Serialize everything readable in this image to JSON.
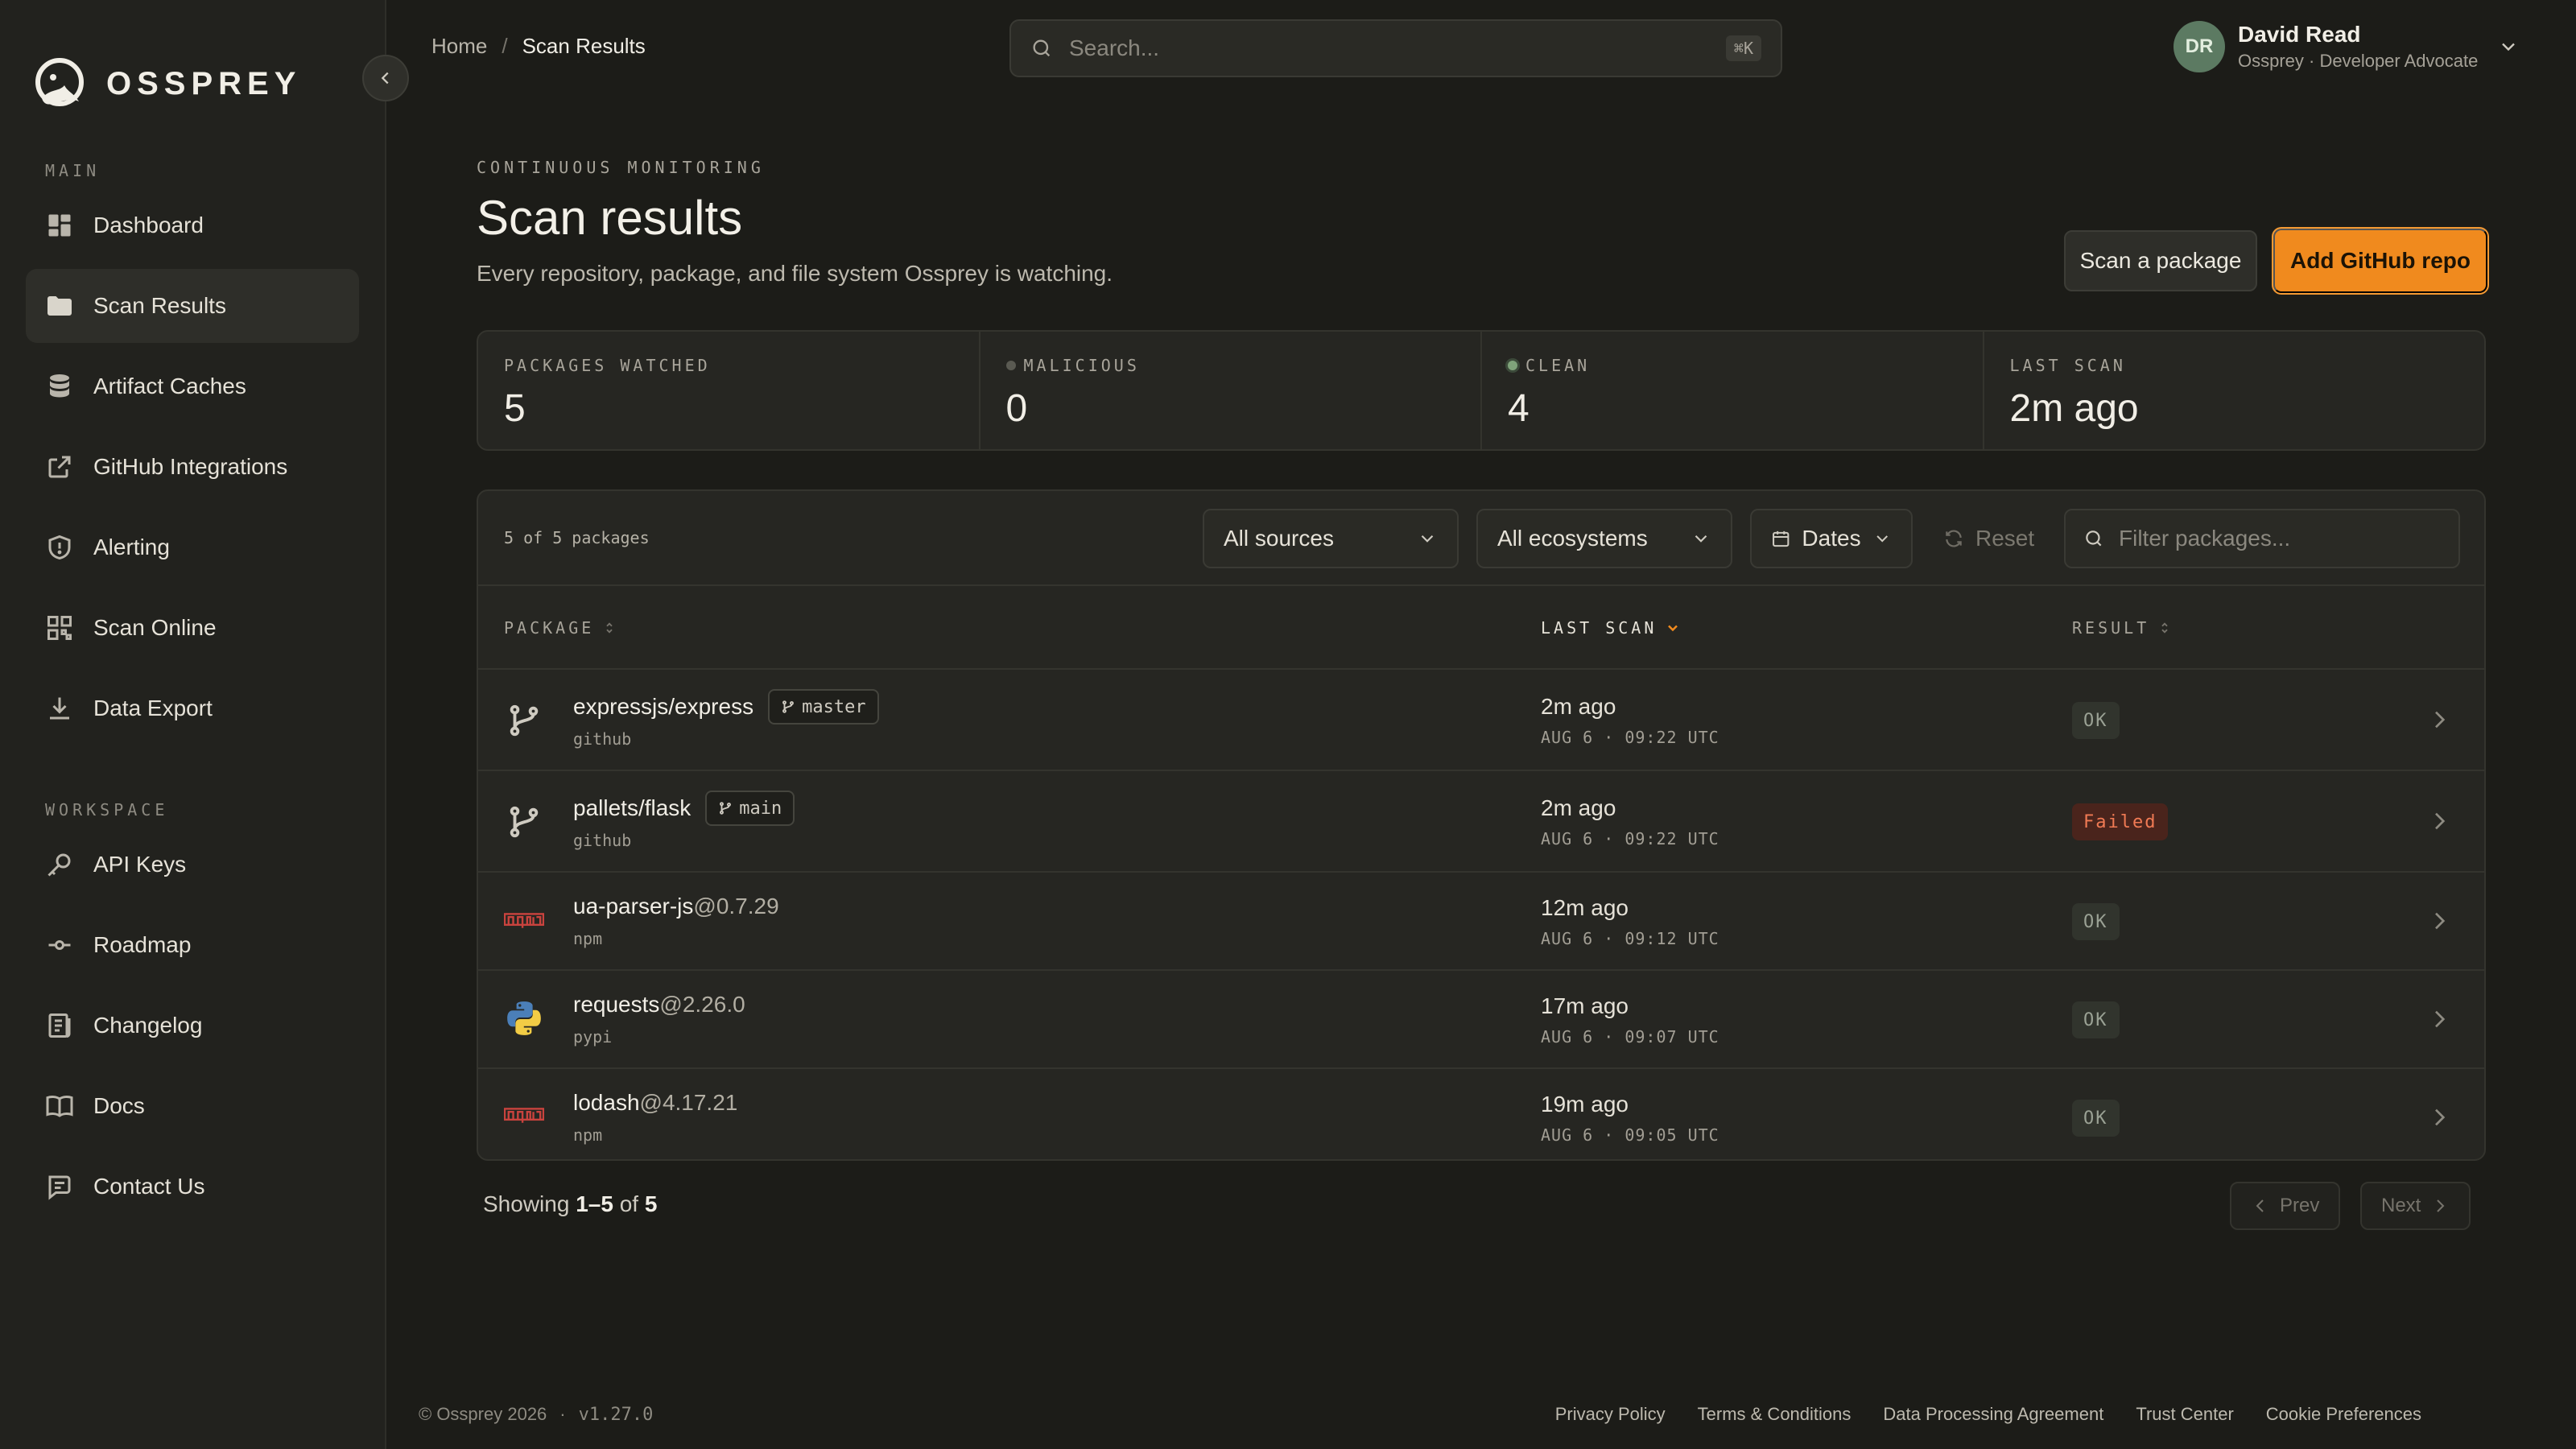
{
  "brand": {
    "name": "OSSPREY"
  },
  "sidebar": {
    "main_label": "MAIN",
    "main_items": [
      {
        "label": "Dashboard",
        "icon": "dashboard-icon"
      },
      {
        "label": "Scan Results",
        "icon": "folder-icon",
        "active": true
      },
      {
        "label": "Artifact Caches",
        "icon": "database-icon"
      },
      {
        "label": "GitHub Integrations",
        "icon": "external-link-icon"
      },
      {
        "label": "Alerting",
        "icon": "shield-icon"
      },
      {
        "label": "Scan Online",
        "icon": "scan-online-icon"
      },
      {
        "label": "Data Export",
        "icon": "download-icon"
      }
    ],
    "workspace_label": "WORKSPACE",
    "workspace_items": [
      {
        "label": "API Keys",
        "icon": "key-icon"
      },
      {
        "label": "Roadmap",
        "icon": "roadmap-icon"
      },
      {
        "label": "Changelog",
        "icon": "changelog-icon"
      },
      {
        "label": "Docs",
        "icon": "book-icon"
      },
      {
        "label": "Contact Us",
        "icon": "chat-icon"
      }
    ]
  },
  "header": {
    "breadcrumb": [
      "Home",
      "Scan Results"
    ],
    "search_placeholder": "Search...",
    "search_shortcut": "⌘K",
    "user": {
      "initials": "DR",
      "name": "David Read",
      "subtitle": "Ossprey · Developer Advocate"
    }
  },
  "page": {
    "eyebrow": "CONTINUOUS MONITORING",
    "title": "Scan results",
    "subtitle": "Every repository, package, and file system Ossprey is watching.",
    "btn_scan_package": "Scan a package",
    "btn_add_repo": "Add GitHub repo"
  },
  "stats": [
    {
      "label": "PACKAGES WATCHED",
      "value": "5"
    },
    {
      "label": "MALICIOUS",
      "value": "0",
      "dot_color": "#5a5a52"
    },
    {
      "label": "CLEAN",
      "value": "4",
      "dot_color": "#7fa37a"
    },
    {
      "label": "LAST SCAN",
      "value": "2m ago"
    }
  ],
  "table": {
    "count_text": "5 of 5 packages",
    "filters": {
      "sources": "All sources",
      "ecosystems": "All ecosystems",
      "dates": "Dates",
      "reset": "Reset",
      "filter_placeholder": "Filter packages..."
    },
    "columns": {
      "package": "PACKAGE",
      "last_scan": "LAST SCAN",
      "result": "RESULT"
    },
    "rows": [
      {
        "name": "expressjs/express",
        "version": "",
        "branch": "master",
        "source": "github",
        "icon": "git-branch-icon",
        "relative": "2m ago",
        "absolute": "AUG 6 · 09:22 UTC",
        "result": "OK",
        "status": "ok"
      },
      {
        "name": "pallets/flask",
        "version": "",
        "branch": "main",
        "source": "github",
        "icon": "git-branch-icon",
        "relative": "2m ago",
        "absolute": "AUG 6 · 09:22 UTC",
        "result": "Failed",
        "status": "failed"
      },
      {
        "name": "ua-parser-js",
        "version": "@0.7.29",
        "branch": "",
        "source": "npm",
        "icon": "npm-icon",
        "relative": "12m ago",
        "absolute": "AUG 6 · 09:12 UTC",
        "result": "OK",
        "status": "ok"
      },
      {
        "name": "requests",
        "version": "@2.26.0",
        "branch": "",
        "source": "pypi",
        "icon": "python-icon",
        "relative": "17m ago",
        "absolute": "AUG 6 · 09:07 UTC",
        "result": "OK",
        "status": "ok"
      },
      {
        "name": "lodash",
        "version": "@4.17.21",
        "branch": "",
        "source": "npm",
        "icon": "npm-icon",
        "relative": "19m ago",
        "absolute": "AUG 6 · 09:05 UTC",
        "result": "OK",
        "status": "ok"
      }
    ]
  },
  "pagination": {
    "showing_prefix": "Showing",
    "range": "1–5",
    "of_word": "of",
    "total": "5",
    "prev": "Prev",
    "next": "Next"
  },
  "footer": {
    "copyright": "© Ossprey 2026",
    "separator": "·",
    "version": "v1.27.0",
    "links": [
      "Privacy Policy",
      "Terms & Conditions",
      "Data Processing Agreement",
      "Trust Center",
      "Cookie Preferences"
    ]
  },
  "colors": {
    "accent": "#f08a1e",
    "background": "#1c1c18",
    "failed": "#f07a54",
    "clean": "#7fa37a"
  }
}
